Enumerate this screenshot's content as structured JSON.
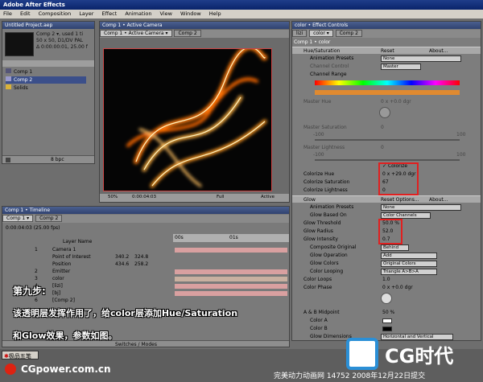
{
  "app": {
    "title": "Adobe After Effects"
  },
  "menu": [
    "File",
    "Edit",
    "Composition",
    "Layer",
    "Effect",
    "Animation",
    "View",
    "Window",
    "Help"
  ],
  "project": {
    "title": "Untitled Project.aep",
    "info_lines": [
      "Comp 2 ▾, used 1 ti",
      "50 x 50, D1/DV PAL",
      "Δ 0:00:00:01, 25.00 f"
    ],
    "items": [
      "Comp 1",
      "Comp 2",
      "Solids"
    ],
    "bpc": "8 bpc"
  },
  "viewer": {
    "title": "Comp 1 • Active Camera",
    "tabs": [
      "Comp 1 • Active Camera ▾",
      "Comp 2"
    ],
    "zoom": "50%",
    "timecode": "0:00:04:03",
    "resolution": "Full",
    "camera": "Active"
  },
  "effect_controls": {
    "title": "color • Effect Controls",
    "tabs": [
      "lizi",
      "color ▾",
      "Comp 2"
    ],
    "layer_path": "Comp 1 • color",
    "hue": {
      "name": "Hue/Saturation",
      "reset": "Reset",
      "about": "About...",
      "animation_presets_label": "Animation Presets",
      "animation_presets_value": "None",
      "channel_control_label": "Channel Control",
      "channel_control_value": "Master",
      "channel_range_label": "Channel Range",
      "master_hue_label": "Master Hue",
      "master_hue_value": "0 x +0.0 dgr",
      "master_sat_label": "Master Saturation",
      "master_sat_value": "0",
      "master_light_label": "Master Lightness",
      "master_light_value": "0",
      "scale_min": "-100",
      "scale_max": "100",
      "colorize_label": "Colorize",
      "colorize_checked": true,
      "colorize_hue_label": "Colorize Hue",
      "colorize_hue_value": "0 x +29.0 dgr",
      "colorize_sat_label": "Colorize Saturation",
      "colorize_sat_value": "67",
      "colorize_light_label": "Colorize Lightness",
      "colorize_light_value": "0"
    },
    "glow": {
      "name": "Glow",
      "reset": "Reset Options...",
      "about": "About...",
      "animation_presets_label": "Animation Presets",
      "animation_presets_value": "None",
      "based_on_label": "Glow Based On",
      "based_on_value": "Color Channels",
      "threshold_label": "Glow Threshold",
      "threshold_value": "50.0 %",
      "radius_label": "Glow Radius",
      "radius_value": "52.0",
      "intensity_label": "Glow Intensity",
      "intensity_value": "0.7",
      "composite_label": "Composite Original",
      "composite_value": "Behind",
      "operation_label": "Glow Operation",
      "operation_value": "Add",
      "colors_label": "Glow Colors",
      "colors_value": "Original Colors",
      "looping_label": "Color Looping",
      "looping_value": "Triangle A>B>A",
      "loops_label": "Color Loops",
      "loops_value": "1.0",
      "phase_label": "Color Phase",
      "phase_value": "0 x +0.0 dgr",
      "midpoint_label": "A & B Midpoint",
      "midpoint_value": "50 %",
      "color_a_label": "Color A",
      "color_b_label": "Color B",
      "dimensions_label": "Glow Dimensions",
      "dimensions_value": "Horizontal and Vertical"
    }
  },
  "timeline": {
    "title": "Comp 1 • Timeline",
    "tabs": [
      "Comp 1 ▾",
      "Comp 2"
    ],
    "timecode": "0:00:04:03 (25.00 fps)",
    "col_layer_name": "Layer Name",
    "layers": [
      {
        "num": "1",
        "name": "Camera 1",
        "v1": "",
        "v2": ""
      },
      {
        "num": "",
        "name": "Point of Interest",
        "v1": "340.2",
        "v2": "324.8"
      },
      {
        "num": "",
        "name": "Position",
        "v1": "434.6",
        "v2": "258.2"
      },
      {
        "num": "2",
        "name": "Emitter",
        "v1": "",
        "v2": ""
      },
      {
        "num": "3",
        "name": "color",
        "v1": "",
        "v2": ""
      },
      {
        "num": "4",
        "name": "[lizi]",
        "v1": "",
        "v2": ""
      },
      {
        "num": "5",
        "name": "[bj]",
        "v1": "",
        "v2": ""
      },
      {
        "num": "6",
        "name": "[Comp 2]",
        "v1": "",
        "v2": ""
      }
    ],
    "ruler": [
      "00s",
      "01s"
    ],
    "switches": "Switches / Modes"
  },
  "annotation": {
    "step": "第九步:",
    "line1": "该透明层发挥作用了，给color层添加Hue/Saturation",
    "line2": "和Glow效果，参数如图。"
  },
  "footer": {
    "badge": "极品五笔",
    "site": "CGpower.com.cn",
    "credit": "完美动力动画网 14752 2008年12月22日提交",
    "logo": "CG时代"
  },
  "colors": {
    "accent_red": "#e02020",
    "title_blue": "#0a246a"
  }
}
